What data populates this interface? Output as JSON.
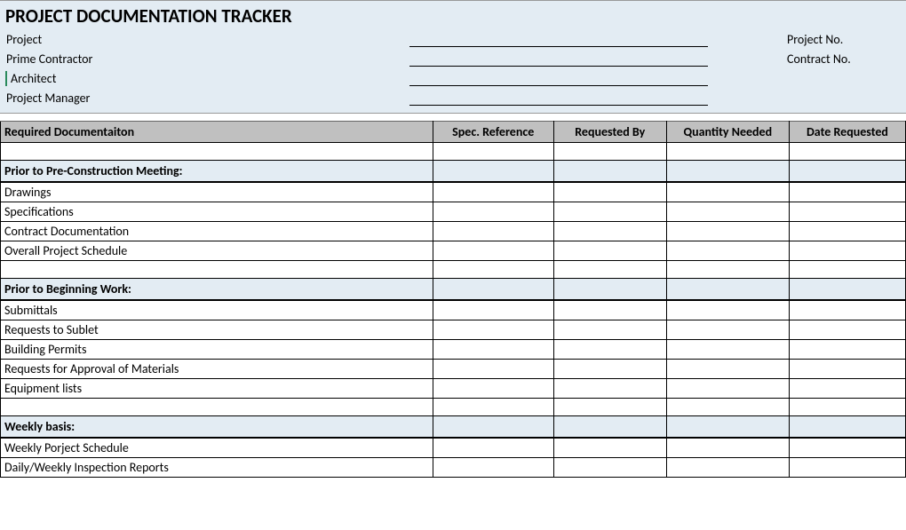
{
  "header": {
    "title": "PROJECT DOCUMENTATION TRACKER",
    "labels": {
      "project": "Project",
      "prime_contractor": "Prime Contractor",
      "architect": "Architect",
      "project_manager": "Project Manager",
      "project_no": "Project No.",
      "contract_no": "Contract No."
    }
  },
  "columns": {
    "documentation": "Required Documentaiton",
    "spec": "Spec. Reference",
    "requested_by": "Requested By",
    "quantity": "Quantity Needed",
    "date_requested": "Date Requested"
  },
  "sections": [
    {
      "title": "Prior to Pre-Construction Meeting:",
      "items": [
        "Drawings",
        "Specifications",
        "Contract Documentation",
        "Overall Project Schedule"
      ]
    },
    {
      "title": "Prior to Beginning Work:",
      "items": [
        "Submittals",
        "Requests to Sublet",
        "Building Permits",
        "Requests for Approval of Materials",
        "Equipment lists"
      ]
    },
    {
      "title": "Weekly basis:",
      "items": [
        "Weekly Porject Schedule",
        "Daily/Weekly Inspection Reports"
      ]
    }
  ]
}
